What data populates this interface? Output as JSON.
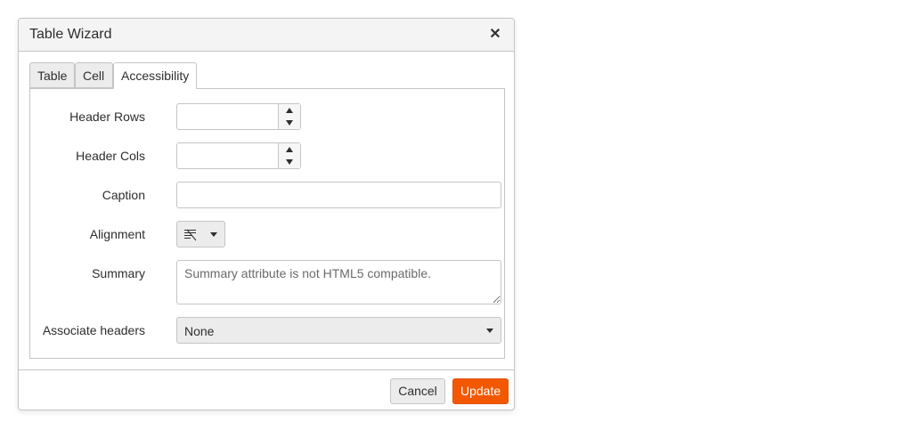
{
  "dialog": {
    "title": "Table Wizard",
    "close_symbol": "✕"
  },
  "tabs": [
    {
      "label": "Table",
      "active": false
    },
    {
      "label": "Cell",
      "active": false
    },
    {
      "label": "Accessibility",
      "active": true
    }
  ],
  "form": {
    "header_rows": {
      "label": "Header Rows",
      "value": ""
    },
    "header_cols": {
      "label": "Header Cols",
      "value": ""
    },
    "caption": {
      "label": "Caption",
      "value": ""
    },
    "alignment": {
      "label": "Alignment",
      "icon": "align-justify-icon"
    },
    "summary": {
      "label": "Summary",
      "placeholder": "Summary attribute is not HTML5 compatible."
    },
    "associate_headers": {
      "label": "Associate headers",
      "value": "None"
    }
  },
  "footer": {
    "cancel_label": "Cancel",
    "update_label": "Update"
  },
  "colors": {
    "accent": "#f35800",
    "border": "#c5c5c5",
    "titlebar_bg": "#f4f4f4"
  }
}
